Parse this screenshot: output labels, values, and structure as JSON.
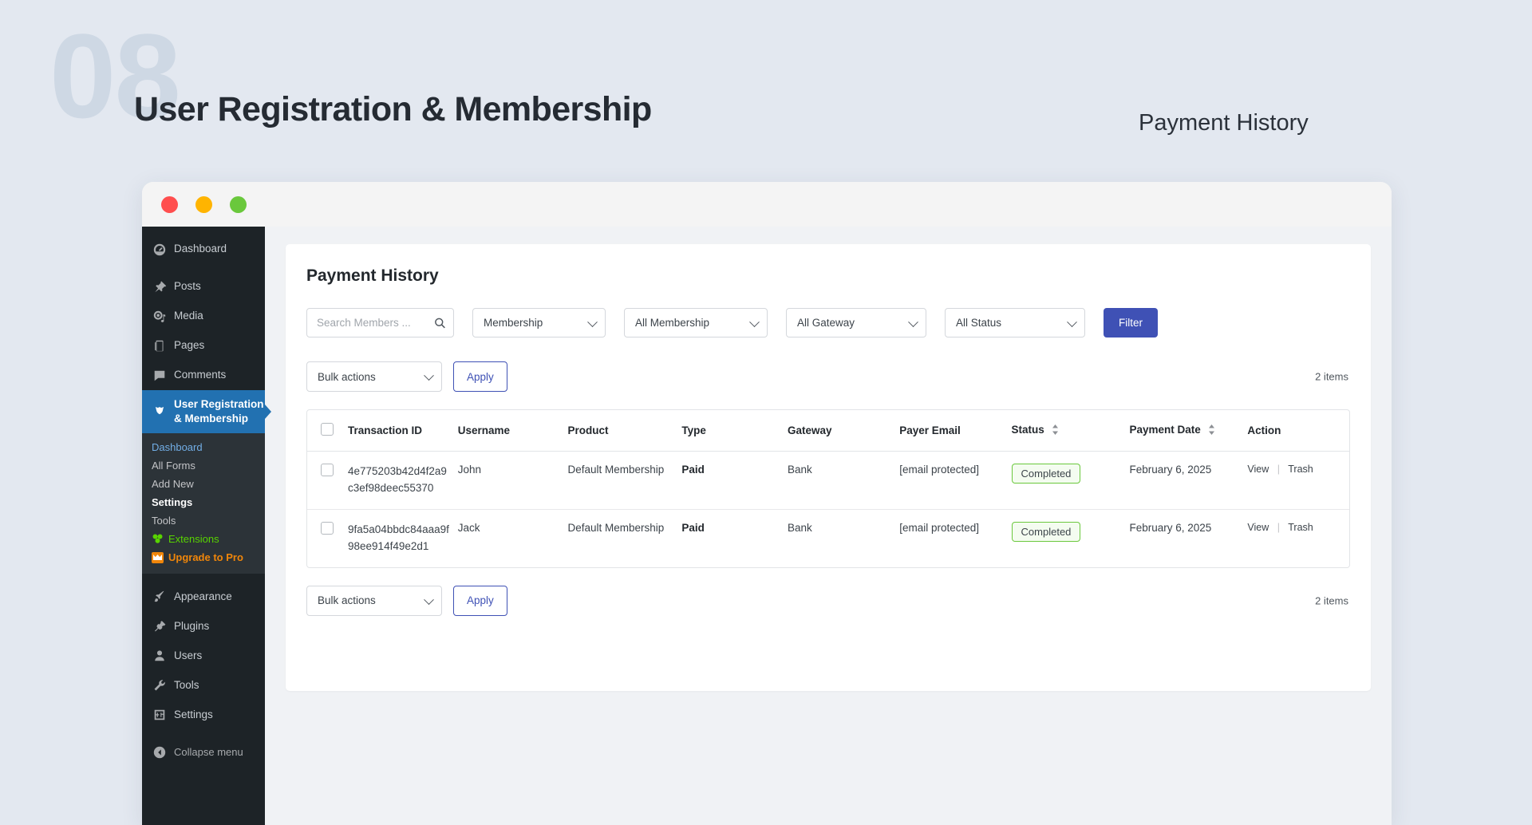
{
  "slide": {
    "number": "08",
    "title": "User Registration & Membership",
    "subtitle": "Payment History",
    "accent_color": "#3f51b5",
    "background_color": "#e3e8f0",
    "number_color": "#ced8e4"
  },
  "window": {
    "dots": {
      "close": "close-dot",
      "minimize": "minimize-dot",
      "maximize": "maximize-dot"
    }
  },
  "sidebar": {
    "items": [
      {
        "label": "Dashboard",
        "icon": "dashboard-icon",
        "active": false
      },
      {
        "label": "Posts",
        "icon": "pin-icon",
        "active": false
      },
      {
        "label": "Media",
        "icon": "media-icon",
        "active": false
      },
      {
        "label": "Pages",
        "icon": "pages-icon",
        "active": false
      },
      {
        "label": "Comments",
        "icon": "comments-icon",
        "active": false
      },
      {
        "label": "User Registration\n& Membership",
        "icon": "user-registration-icon",
        "active": true
      }
    ],
    "item_labels": {
      "dashboard": "Dashboard",
      "posts": "Posts",
      "media": "Media",
      "pages": "Pages",
      "comments": "Comments",
      "user_registration_line1": "User Registration",
      "user_registration_line2": "& Membership"
    },
    "submenu": {
      "dashboard": "Dashboard",
      "all_forms": "All Forms",
      "add_new": "Add New",
      "settings": "Settings",
      "tools": "Tools",
      "extensions": "Extensions",
      "upgrade": "Upgrade to Pro"
    },
    "bottom": {
      "appearance": "Appearance",
      "plugins": "Plugins",
      "users": "Users",
      "tools": "Tools",
      "settings": "Settings",
      "collapse": "Collapse menu"
    }
  },
  "main": {
    "title": "Payment History",
    "filters": {
      "search_placeholder": "Search Members ...",
      "search_value": "",
      "membership": "Membership",
      "all_membership": "All Membership",
      "all_gateway": "All Gateway",
      "all_status": "All Status",
      "filter_button": "Filter"
    },
    "bulk_top": {
      "select": "Bulk actions",
      "apply": "Apply",
      "items": "2 items"
    },
    "bulk_bottom": {
      "select": "Bulk actions",
      "apply": "Apply",
      "items": "2 items"
    },
    "table": {
      "columns": [
        "Transaction ID",
        "Username",
        "Product",
        "Type",
        "Gateway",
        "Payer Email",
        "Status",
        "Payment Date",
        "Action"
      ],
      "sortable": [
        "Status",
        "Payment Date"
      ],
      "rows": [
        {
          "transaction_id": "4e775203b42d4f2a9c3ef98deec55370",
          "username": "John",
          "product": "Default Membership",
          "type": "Paid",
          "gateway": "Bank",
          "payer_email": "[email protected]",
          "status": "Completed",
          "payment_date": "February 6, 2025",
          "action_view": "View",
          "action_trash": "Trash"
        },
        {
          "transaction_id": "9fa5a04bbdc84aaa9f98ee914f49e2d1",
          "username": "Jack",
          "product": "Default Membership",
          "type": "Paid",
          "gateway": "Bank",
          "payer_email": "[email protected]",
          "status": "Completed",
          "payment_date": "February 6, 2025",
          "action_view": "View",
          "action_trash": "Trash"
        }
      ]
    }
  }
}
